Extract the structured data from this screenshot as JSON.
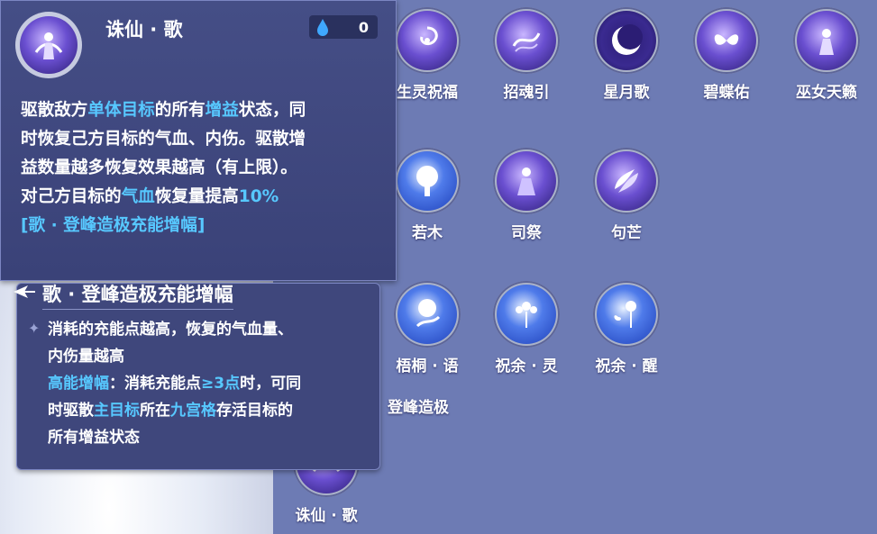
{
  "tooltip": {
    "title": "诛仙 · 歌",
    "counter_value": "0",
    "desc_line1_a": "驱散敌方",
    "desc_line1_hl1": "单体目标",
    "desc_line1_b": "的所有",
    "desc_line1_hl2": "增益",
    "desc_line1_c": "状态，同",
    "desc_line2": "时恢复己方目标的气血、内伤。驱散增",
    "desc_line3": "益数量越多恢复效果越高（有上限）。",
    "desc_line4_a": "对己方目标的",
    "desc_line4_hl1": "气血",
    "desc_line4_b": "恢复量提高",
    "desc_line4_hl2": "10%",
    "desc_line5_hl": "[歌 · 登峰造极充能增幅]"
  },
  "tip2": {
    "title": "歌 · 登峰造极充能增幅",
    "line1": "消耗的充能点越高，恢复的气血量、",
    "line2": "内伤量越高",
    "line3_hl1": "高能增幅",
    "line3_a": "：消耗充能点",
    "line3_hl2": "≥3点",
    "line3_b": "时，可同",
    "line4_a": "时驱散",
    "line4_hl1": "主目标",
    "line4_b": "所在",
    "line4_hl2": "九宫格",
    "line4_c": "存活目标的",
    "line5": "所有增益状态"
  },
  "skills": {
    "s1": "生灵祝福",
    "s2": "招魂引",
    "s3": "星月歌",
    "s4": "碧蝶佑",
    "s5": "巫女天籁",
    "s6": "若木",
    "s7": "司祭",
    "s8": "句芒",
    "s9": "梧桐 · 语",
    "s10": "祝余 · 灵",
    "s11": "祝余 · 醒",
    "s12": "登峰造极",
    "s13": "诛仙 · 歌"
  },
  "colors": {
    "highlight": "#57c8ff",
    "panel": "#6d7bb4",
    "tooltip_bg": "#454e86"
  }
}
